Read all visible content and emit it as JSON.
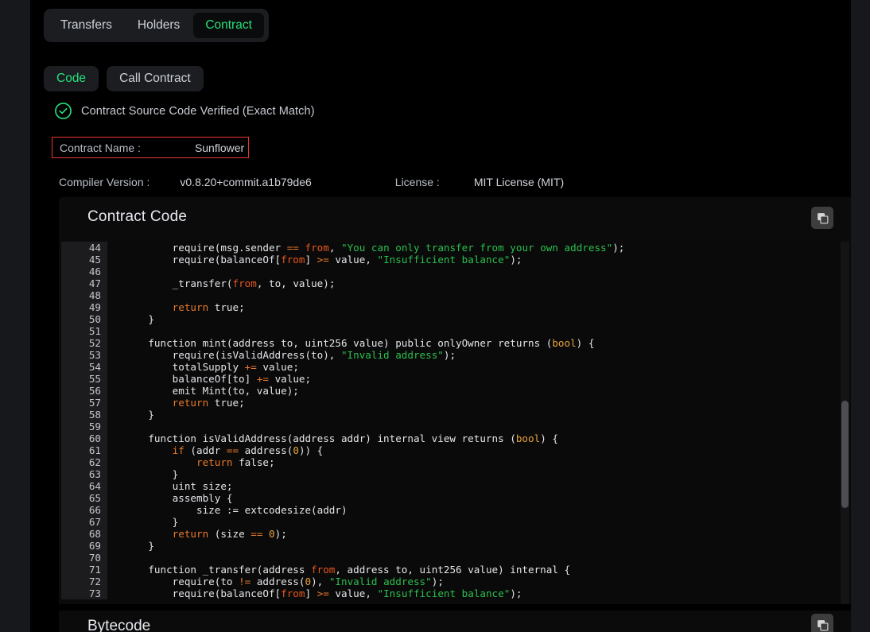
{
  "tabs": {
    "items": [
      {
        "label": "Transfers",
        "active": false
      },
      {
        "label": "Holders",
        "active": false
      },
      {
        "label": "Contract",
        "active": true
      }
    ]
  },
  "subtabs": {
    "items": [
      {
        "label": "Code",
        "active": true
      },
      {
        "label": "Call Contract",
        "active": false
      }
    ]
  },
  "verification": {
    "icon": "check-circle-icon",
    "status_text": "Contract Source Code Verified (Exact Match)",
    "status_color": "#28e07a"
  },
  "details": {
    "contract_name_label": "Contract Name :",
    "contract_name_value": "Sunflower",
    "highlight_color": "#e8352e",
    "compiler_label": "Compiler Version :",
    "compiler_value": "v0.8.20+commit.a1b79de6",
    "license_label": "License :",
    "license_value": "MIT License (MIT)"
  },
  "contract_code": {
    "title": "Contract Code",
    "copy_icon": "copy-icon",
    "first_line": 44,
    "lines": [
      {
        "n": 44,
        "tokens": [
          {
            "t": "        require(msg.sender ",
            "c": ""
          },
          {
            "t": "==",
            "c": "tk-kw"
          },
          {
            "t": " ",
            "c": ""
          },
          {
            "t": "from",
            "c": "tk-var"
          },
          {
            "t": ", ",
            "c": ""
          },
          {
            "t": "\"You can only transfer from your own address\"",
            "c": "tk-str"
          },
          {
            "t": ");",
            "c": ""
          }
        ]
      },
      {
        "n": 45,
        "tokens": [
          {
            "t": "        require(balanceOf[",
            "c": ""
          },
          {
            "t": "from",
            "c": "tk-var"
          },
          {
            "t": "] ",
            "c": ""
          },
          {
            "t": ">=",
            "c": "tk-kw"
          },
          {
            "t": " value, ",
            "c": ""
          },
          {
            "t": "\"Insufficient balance\"",
            "c": "tk-str"
          },
          {
            "t": ");",
            "c": ""
          }
        ]
      },
      {
        "n": 46,
        "tokens": [
          {
            "t": "",
            "c": ""
          }
        ]
      },
      {
        "n": 47,
        "tokens": [
          {
            "t": "        _transfer(",
            "c": ""
          },
          {
            "t": "from",
            "c": "tk-var"
          },
          {
            "t": ", to, value);",
            "c": ""
          }
        ]
      },
      {
        "n": 48,
        "tokens": [
          {
            "t": "",
            "c": ""
          }
        ]
      },
      {
        "n": 49,
        "tokens": [
          {
            "t": "        ",
            "c": ""
          },
          {
            "t": "return",
            "c": "tk-kw"
          },
          {
            "t": " true;",
            "c": ""
          }
        ]
      },
      {
        "n": 50,
        "tokens": [
          {
            "t": "    }",
            "c": ""
          }
        ]
      },
      {
        "n": 51,
        "tokens": [
          {
            "t": "",
            "c": ""
          }
        ]
      },
      {
        "n": 52,
        "tokens": [
          {
            "t": "    function mint(address to, uint256 value) public onlyOwner returns (",
            "c": ""
          },
          {
            "t": "bool",
            "c": "tk-typ"
          },
          {
            "t": ") {",
            "c": ""
          }
        ]
      },
      {
        "n": 53,
        "tokens": [
          {
            "t": "        require(isValidAddress(to), ",
            "c": ""
          },
          {
            "t": "\"Invalid address\"",
            "c": "tk-str"
          },
          {
            "t": ");",
            "c": ""
          }
        ]
      },
      {
        "n": 54,
        "tokens": [
          {
            "t": "        totalSupply ",
            "c": ""
          },
          {
            "t": "+=",
            "c": "tk-kw"
          },
          {
            "t": " value;",
            "c": ""
          }
        ]
      },
      {
        "n": 55,
        "tokens": [
          {
            "t": "        balanceOf[to] ",
            "c": ""
          },
          {
            "t": "+=",
            "c": "tk-kw"
          },
          {
            "t": " value;",
            "c": ""
          }
        ]
      },
      {
        "n": 56,
        "tokens": [
          {
            "t": "        emit Mint(to, value);",
            "c": ""
          }
        ]
      },
      {
        "n": 57,
        "tokens": [
          {
            "t": "        ",
            "c": ""
          },
          {
            "t": "return",
            "c": "tk-kw"
          },
          {
            "t": " true;",
            "c": ""
          }
        ]
      },
      {
        "n": 58,
        "tokens": [
          {
            "t": "    }",
            "c": ""
          }
        ]
      },
      {
        "n": 59,
        "tokens": [
          {
            "t": "",
            "c": ""
          }
        ]
      },
      {
        "n": 60,
        "tokens": [
          {
            "t": "    function isValidAddress(address addr) internal view returns (",
            "c": ""
          },
          {
            "t": "bool",
            "c": "tk-typ"
          },
          {
            "t": ") {",
            "c": ""
          }
        ]
      },
      {
        "n": 61,
        "tokens": [
          {
            "t": "        ",
            "c": ""
          },
          {
            "t": "if",
            "c": "tk-kw"
          },
          {
            "t": " (addr ",
            "c": ""
          },
          {
            "t": "==",
            "c": "tk-kw"
          },
          {
            "t": " address(",
            "c": ""
          },
          {
            "t": "0",
            "c": "tk-num"
          },
          {
            "t": ")) {",
            "c": ""
          }
        ]
      },
      {
        "n": 62,
        "tokens": [
          {
            "t": "            ",
            "c": ""
          },
          {
            "t": "return",
            "c": "tk-kw"
          },
          {
            "t": " false;",
            "c": ""
          }
        ]
      },
      {
        "n": 63,
        "tokens": [
          {
            "t": "        }",
            "c": ""
          }
        ]
      },
      {
        "n": 64,
        "tokens": [
          {
            "t": "        uint size;",
            "c": ""
          }
        ]
      },
      {
        "n": 65,
        "tokens": [
          {
            "t": "        assembly {",
            "c": ""
          }
        ]
      },
      {
        "n": 66,
        "tokens": [
          {
            "t": "            size := extcodesize(addr)",
            "c": ""
          }
        ]
      },
      {
        "n": 67,
        "tokens": [
          {
            "t": "        }",
            "c": ""
          }
        ]
      },
      {
        "n": 68,
        "tokens": [
          {
            "t": "        ",
            "c": ""
          },
          {
            "t": "return",
            "c": "tk-kw"
          },
          {
            "t": " (size ",
            "c": ""
          },
          {
            "t": "==",
            "c": "tk-kw"
          },
          {
            "t": " ",
            "c": ""
          },
          {
            "t": "0",
            "c": "tk-num"
          },
          {
            "t": ");",
            "c": ""
          }
        ]
      },
      {
        "n": 69,
        "tokens": [
          {
            "t": "    }",
            "c": ""
          }
        ]
      },
      {
        "n": 70,
        "tokens": [
          {
            "t": "",
            "c": ""
          }
        ]
      },
      {
        "n": 71,
        "tokens": [
          {
            "t": "    function _transfer(address ",
            "c": ""
          },
          {
            "t": "from",
            "c": "tk-var"
          },
          {
            "t": ", address to, uint256 value) internal {",
            "c": ""
          }
        ]
      },
      {
        "n": 72,
        "tokens": [
          {
            "t": "        require(to ",
            "c": ""
          },
          {
            "t": "!=",
            "c": "tk-kw"
          },
          {
            "t": " address(",
            "c": ""
          },
          {
            "t": "0",
            "c": "tk-num"
          },
          {
            "t": "), ",
            "c": ""
          },
          {
            "t": "\"Invalid address\"",
            "c": "tk-str"
          },
          {
            "t": ");",
            "c": ""
          }
        ]
      },
      {
        "n": 73,
        "tokens": [
          {
            "t": "        require(balanceOf[",
            "c": ""
          },
          {
            "t": "from",
            "c": "tk-var"
          },
          {
            "t": "] ",
            "c": ""
          },
          {
            "t": ">=",
            "c": "tk-kw"
          },
          {
            "t": " value, ",
            "c": ""
          },
          {
            "t": "\"Insufficient balance\"",
            "c": "tk-str"
          },
          {
            "t": ");",
            "c": ""
          }
        ]
      }
    ]
  },
  "bytecode": {
    "title": "Bytecode",
    "copy_icon": "copy-icon"
  }
}
